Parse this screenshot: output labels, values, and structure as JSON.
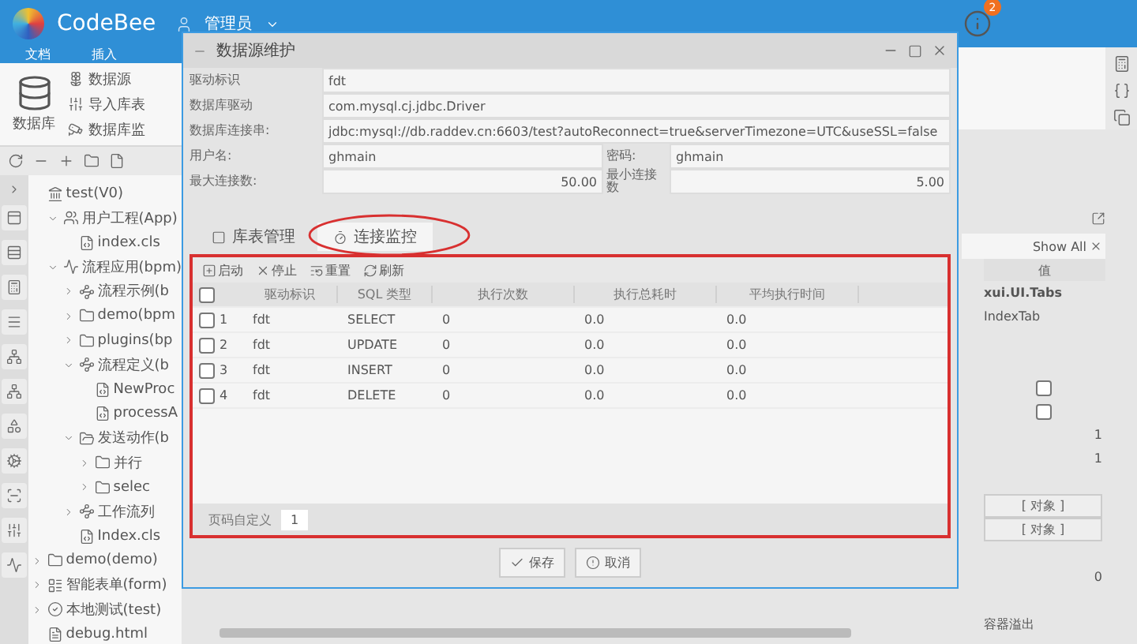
{
  "header": {
    "brand": "CodeBee",
    "user": "管理员",
    "notification_count": "2"
  },
  "menu": [
    "文档",
    "插入"
  ],
  "ribbon": {
    "main": "数据库",
    "items": [
      {
        "label": "数据源",
        "kind": "source"
      },
      {
        "label": "导入库表",
        "kind": "import"
      },
      {
        "label": "数据库监",
        "kind": "monitor"
      }
    ]
  },
  "tree": [
    {
      "label": "test(V0)",
      "kind": "root",
      "children": [
        {
          "label": "用户工程(App)",
          "kind": "app",
          "expanded": true,
          "children": [
            {
              "label": "index.cls",
              "kind": "file"
            }
          ]
        },
        {
          "label": "流程应用(bpm)",
          "kind": "flow",
          "expanded": true,
          "children": [
            {
              "label": "流程示例(b",
              "kind": "nodes",
              "expanded": false
            },
            {
              "label": "demo(bpm",
              "kind": "folder",
              "expanded": false
            },
            {
              "label": "plugins(bp",
              "kind": "folder",
              "expanded": false
            },
            {
              "label": "流程定义(b",
              "kind": "nodes",
              "expanded": true,
              "children": [
                {
                  "label": "NewProc",
                  "kind": "file"
                },
                {
                  "label": "processA",
                  "kind": "file"
                }
              ]
            },
            {
              "label": "发送动作(b",
              "kind": "open-folder",
              "expanded": true,
              "children": [
                {
                  "label": "并行",
                  "kind": "folder",
                  "expanded": false
                },
                {
                  "label": "selec",
                  "kind": "folder",
                  "expanded": false
                }
              ]
            },
            {
              "label": "工作流列",
              "kind": "nodes",
              "expanded": false
            },
            {
              "label": "Index.cls",
              "kind": "file"
            }
          ]
        }
      ]
    },
    {
      "label": "demo(demo)",
      "kind": "folder",
      "expanded": false
    },
    {
      "label": "智能表单(form)",
      "kind": "form",
      "expanded": false
    },
    {
      "label": "本地测试(test)",
      "kind": "test",
      "expanded": false
    },
    {
      "label": "debug.html",
      "kind": "html"
    }
  ],
  "dialog": {
    "title": "数据源维护",
    "form": [
      {
        "cells": [
          {
            "label": "驱动标识",
            "value": "fdt",
            "kind": "text"
          }
        ]
      },
      {
        "cells": [
          {
            "label": "数据库驱动",
            "value": "com.mysql.cj.jdbc.Driver",
            "kind": "text"
          }
        ]
      },
      {
        "cells": [
          {
            "label": "数据库连接串:",
            "value": "jdbc:mysql://db.raddev.cn:6603/test?autoReconnect=true&serverTimezone=UTC&useSSL=false",
            "kind": "text"
          }
        ]
      },
      {
        "cells": [
          {
            "label": "用户名:",
            "value": "ghmain",
            "kind": "text"
          },
          {
            "label": "密码:",
            "value": "ghmain",
            "kind": "text"
          }
        ]
      },
      {
        "cells": [
          {
            "label": "最大连接数:",
            "value": "50.00",
            "kind": "number"
          },
          {
            "label": "最小连接数",
            "value": "5.00",
            "kind": "number"
          }
        ]
      }
    ],
    "tabs": [
      {
        "label": "库表管理",
        "kind": "table",
        "selected": false,
        "circled": false
      },
      {
        "label": "连接监控",
        "kind": "monitor",
        "selected": true,
        "circled": true
      }
    ],
    "toolbar": [
      {
        "label": "启动",
        "kind": "start"
      },
      {
        "label": "停止",
        "kind": "stop"
      },
      {
        "label": "重置",
        "kind": "reset"
      },
      {
        "label": "刷新",
        "kind": "refresh"
      }
    ],
    "grid": {
      "all_checked": false,
      "columns": [
        "驱动标识",
        "SQL 类型",
        "执行次数",
        "执行总耗时",
        "平均执行时间"
      ],
      "rows": [
        {
          "index": "1",
          "checked": false,
          "cells": [
            "fdt",
            "SELECT",
            "0",
            "0.0",
            "0.0"
          ]
        },
        {
          "index": "2",
          "checked": false,
          "cells": [
            "fdt",
            "UPDATE",
            "0",
            "0.0",
            "0.0"
          ]
        },
        {
          "index": "3",
          "checked": false,
          "cells": [
            "fdt",
            "INSERT",
            "0",
            "0.0",
            "0.0"
          ]
        },
        {
          "index": "4",
          "checked": false,
          "cells": [
            "fdt",
            "DELETE",
            "0",
            "0.0",
            "0.0"
          ]
        }
      ]
    },
    "pager": {
      "label": "页码自定义",
      "value": "1"
    },
    "buttons": [
      {
        "label": "保存",
        "kind": "save"
      },
      {
        "label": "取消",
        "kind": "cancel"
      }
    ]
  },
  "properties": {
    "filter": "Show All",
    "column": "值",
    "rows": [
      {
        "kind": "bold",
        "value": "xui.UI.Tabs"
      },
      {
        "kind": "text",
        "value": "IndexTab"
      },
      {
        "kind": "blank"
      },
      {
        "kind": "blank"
      },
      {
        "kind": "check",
        "checked": false
      },
      {
        "kind": "check",
        "checked": false
      },
      {
        "kind": "number",
        "value": "1"
      },
      {
        "kind": "number",
        "value": "1"
      },
      {
        "kind": "blank"
      },
      {
        "kind": "object",
        "value": "[ 对象 ]"
      },
      {
        "kind": "object",
        "value": "[ 对象 ]"
      },
      {
        "kind": "blank"
      },
      {
        "kind": "number",
        "value": "0"
      },
      {
        "kind": "blank"
      },
      {
        "kind": "text",
        "value": "容器溢出"
      }
    ]
  }
}
